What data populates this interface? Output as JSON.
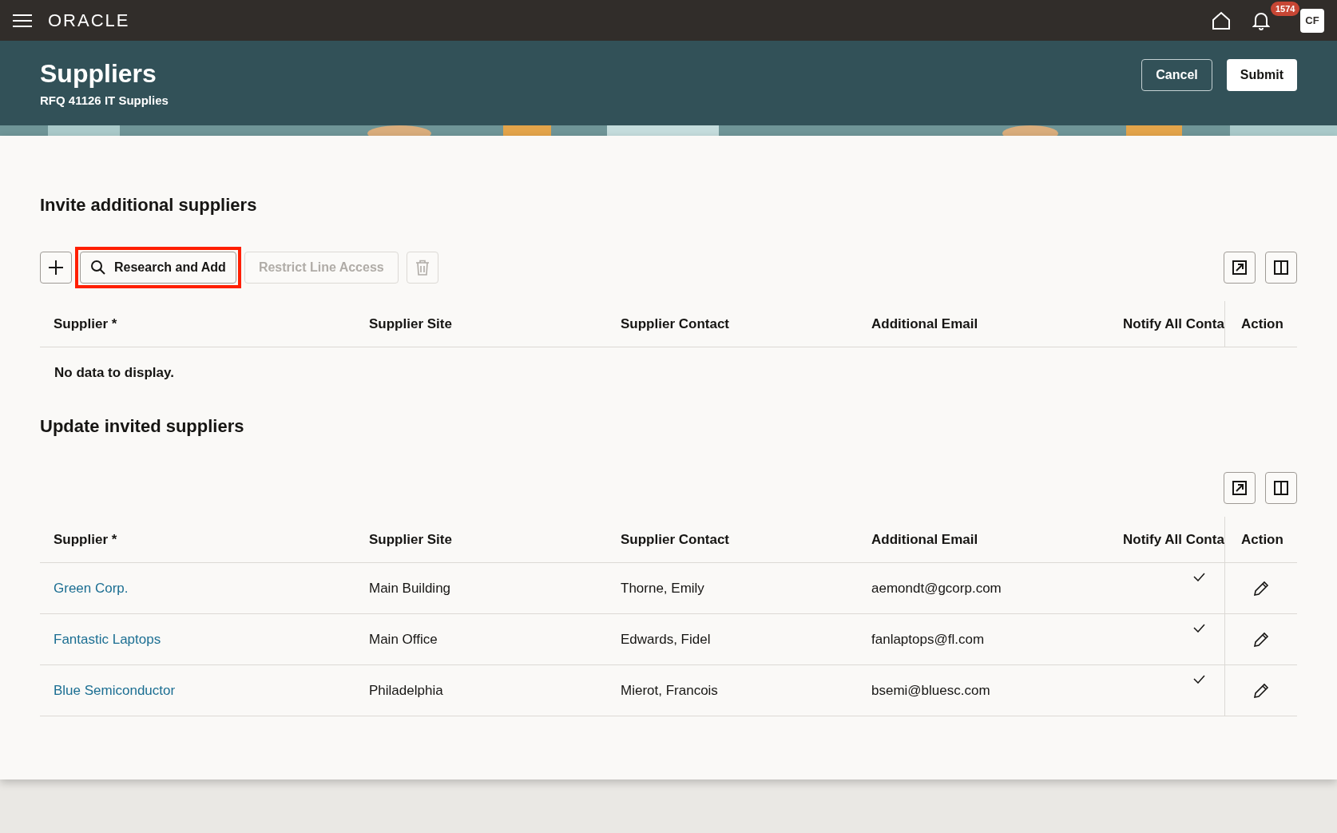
{
  "top_bar": {
    "logo": "ORACLE",
    "notification_count": "1574",
    "avatar": "CF"
  },
  "header": {
    "title": "Suppliers",
    "subtitle": "RFQ 41126 IT Supplies",
    "buttons": [
      {
        "label": "Cancel",
        "kind": "outline"
      },
      {
        "label": "Submit",
        "kind": "primary"
      }
    ]
  },
  "invite_section": {
    "title": "Invite additional suppliers",
    "toolbar": [
      {
        "kind": "add",
        "disabled": false,
        "highlighted": false
      },
      {
        "kind": "search",
        "label": "Research and Add",
        "disabled": false,
        "highlighted": true
      },
      {
        "kind": "text",
        "label": "Restrict Line Access",
        "disabled": true,
        "highlighted": false
      },
      {
        "kind": "delete",
        "disabled": true,
        "highlighted": false
      }
    ],
    "columns": [
      "Supplier *",
      "Supplier Site",
      "Supplier Contact",
      "Additional Email",
      "Notify All Conta",
      "Action"
    ],
    "empty_message": "No data to display."
  },
  "update_section": {
    "title": "Update invited suppliers",
    "columns": [
      "Supplier *",
      "Supplier Site",
      "Supplier Contact",
      "Additional Email",
      "Notify All Conta",
      "Action"
    ],
    "rows": [
      {
        "supplier": "Green Corp.",
        "site": "Main Building",
        "contact": "Thorne, Emily",
        "email": "aemondt@gcorp.com",
        "notify_all": true
      },
      {
        "supplier": "Fantastic Laptops",
        "site": "Main Office",
        "contact": "Edwards, Fidel",
        "email": "fanlaptops@fl.com",
        "notify_all": true
      },
      {
        "supplier": "Blue Semiconductor",
        "site": "Philadelphia",
        "contact": "Mierot, Francois",
        "email": "bsemi@bluesc.com",
        "notify_all": true
      }
    ]
  }
}
